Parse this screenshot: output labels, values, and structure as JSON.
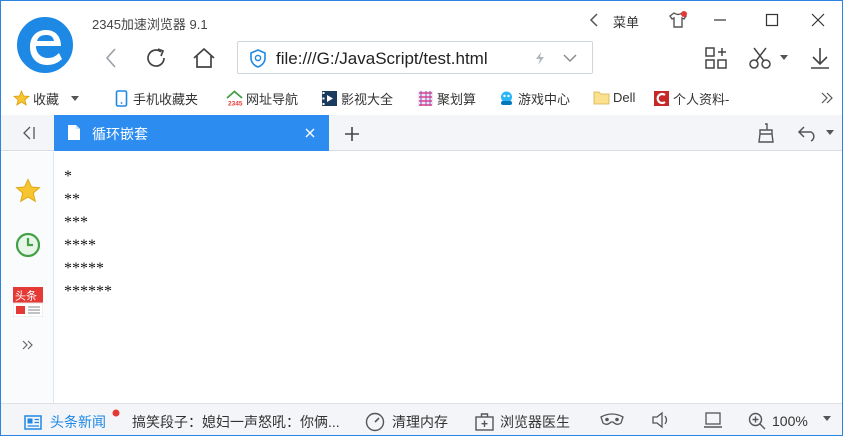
{
  "window": {
    "app_title": "2345加速浏览器 9.1"
  },
  "titlebar": {
    "menu_label": "菜单"
  },
  "address_bar": {
    "url": "file:///G:/JavaScript/test.html"
  },
  "bookmarks": [
    {
      "label": "收藏",
      "icon": "star-icon"
    },
    {
      "label": "手机收藏夹",
      "icon": "phone-icon"
    },
    {
      "label": "网址导航",
      "icon": "house-2345-icon"
    },
    {
      "label": "影视大全",
      "icon": "film-icon"
    },
    {
      "label": "聚划算",
      "icon": "juhuasuan-icon"
    },
    {
      "label": "游戏中心",
      "icon": "game-icon"
    },
    {
      "label": "Dell",
      "icon": "folder-icon"
    },
    {
      "label": "个人资料-",
      "icon": "c-logo-icon"
    }
  ],
  "tab": {
    "title": "循环嵌套"
  },
  "content": {
    "lines": [
      "*",
      "**",
      "***",
      "****",
      "*****",
      "******"
    ]
  },
  "status_bar": {
    "news_label": "头条新闻",
    "joke_text": "搞笑段子：媳妇一声怒吼：你俩...",
    "clean_memory": "清理内存",
    "doctor": "浏览器医生",
    "zoom": "100%"
  },
  "colors": {
    "accent": "#2d8cf0",
    "logo_blue": "#1e88e5"
  }
}
